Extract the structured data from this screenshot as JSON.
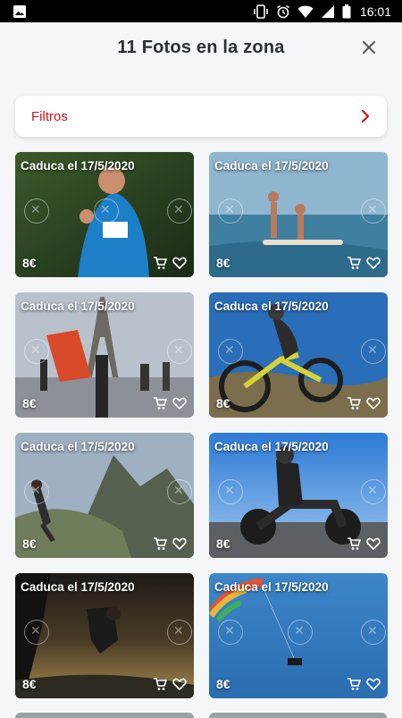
{
  "status_bar": {
    "time": "16:01"
  },
  "header": {
    "title": "11 Fotos en la zona"
  },
  "filters": {
    "label": "Filtros"
  },
  "photos": [
    {
      "expiry": "Caduca el 17/5/2020",
      "price": "8€"
    },
    {
      "expiry": "Caduca el 17/5/2020",
      "price": "8€"
    },
    {
      "expiry": "Caduca el 17/5/2020",
      "price": "8€"
    },
    {
      "expiry": "Caduca el 17/5/2020",
      "price": "8€"
    },
    {
      "expiry": "Caduca el 17/5/2020",
      "price": "8€"
    },
    {
      "expiry": "Caduca el 17/5/2020",
      "price": "8€"
    },
    {
      "expiry": "Caduca el 17/5/2020",
      "price": "8€"
    },
    {
      "expiry": "Caduca el 17/5/2020",
      "price": "8€"
    }
  ],
  "colors": {
    "accent": "#d0111b",
    "background": "#f4f6f8",
    "title": "#2a2f36"
  }
}
